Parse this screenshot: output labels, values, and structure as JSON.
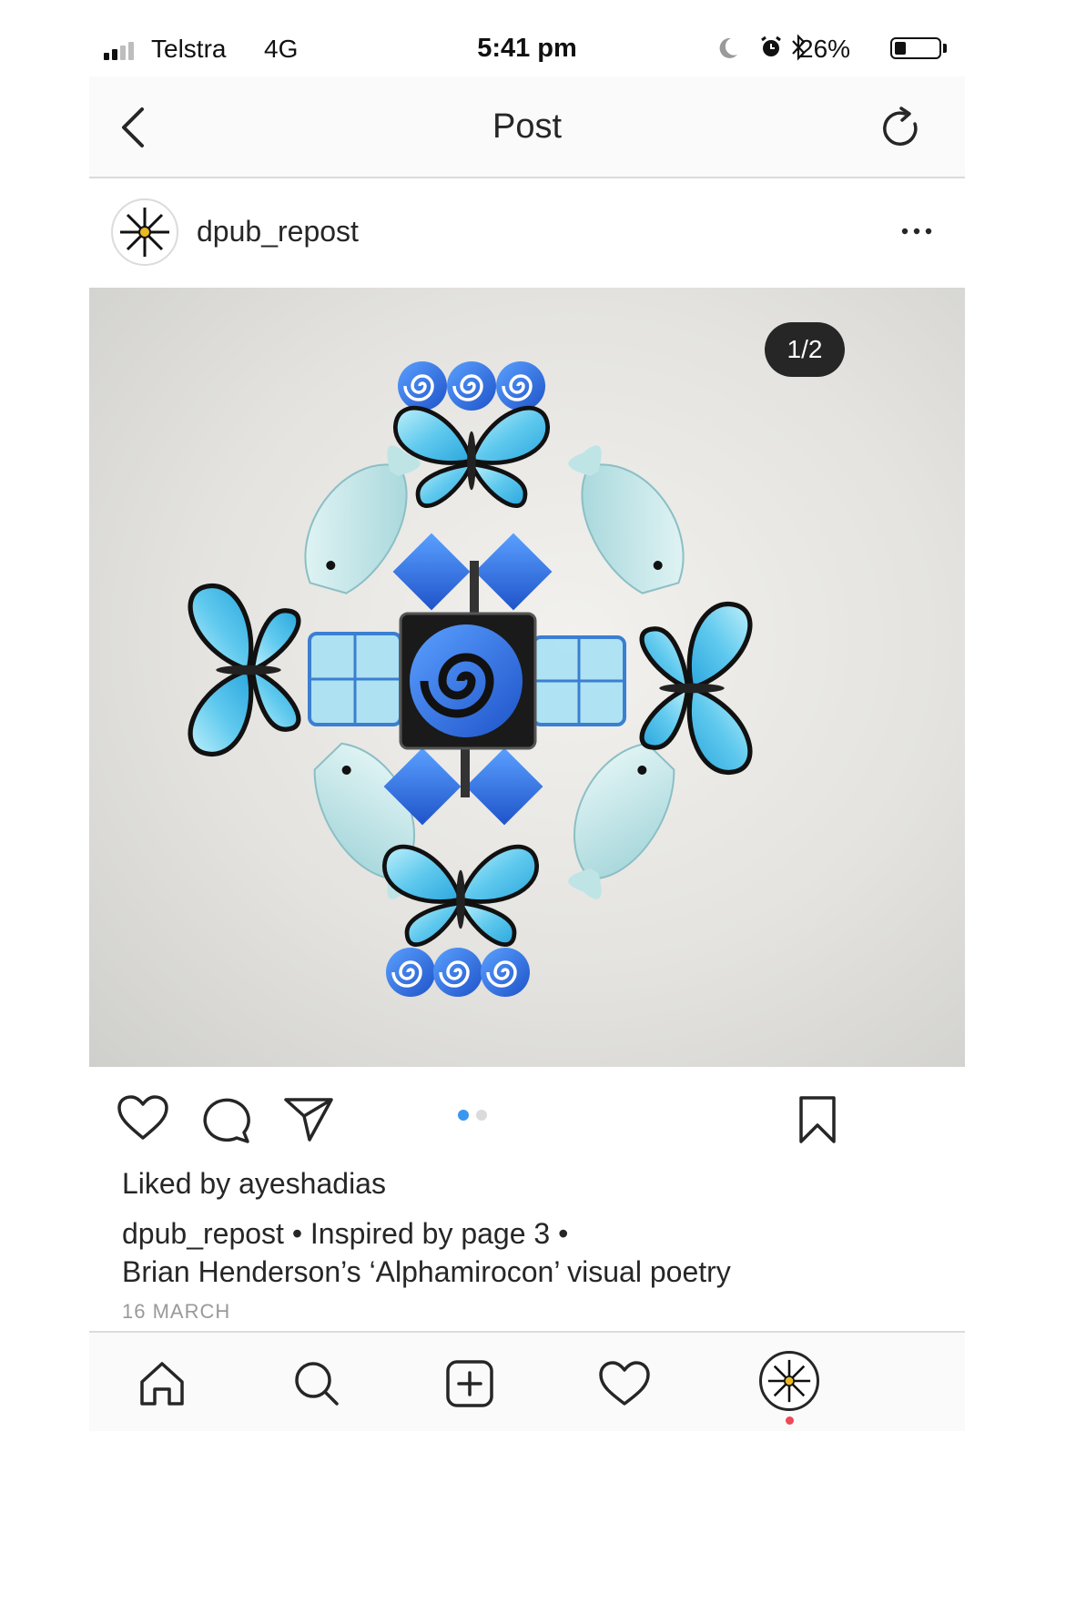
{
  "status_bar": {
    "carrier": "Telstra",
    "network": "4G",
    "time": "5:41 pm",
    "battery_percent": "26%",
    "battery_level": 0.26,
    "signal_bars": 2
  },
  "nav": {
    "title": "Post",
    "back_icon": "chevron-left-icon",
    "refresh_icon": "refresh-icon"
  },
  "post": {
    "username": "dpub_repost",
    "image_counter": "1/2",
    "current_image": 1,
    "total_images": 2,
    "liked_by_prefix": "Liked by ",
    "liked_by_user": "ayeshadias",
    "caption_user": "dpub_repost",
    "caption_line1": " • Inspired by page 3 •",
    "caption_line2": "Brian Henderson’s ‘Alphamirocon’ visual poetry",
    "date": "16 MARCH"
  },
  "colors": {
    "accent": "#3897f0",
    "notification": "#ed4956",
    "text": "#262626",
    "muted": "#999999",
    "butterfly": "#5fc9ee",
    "spiral_blue": "#2f6fe0"
  }
}
